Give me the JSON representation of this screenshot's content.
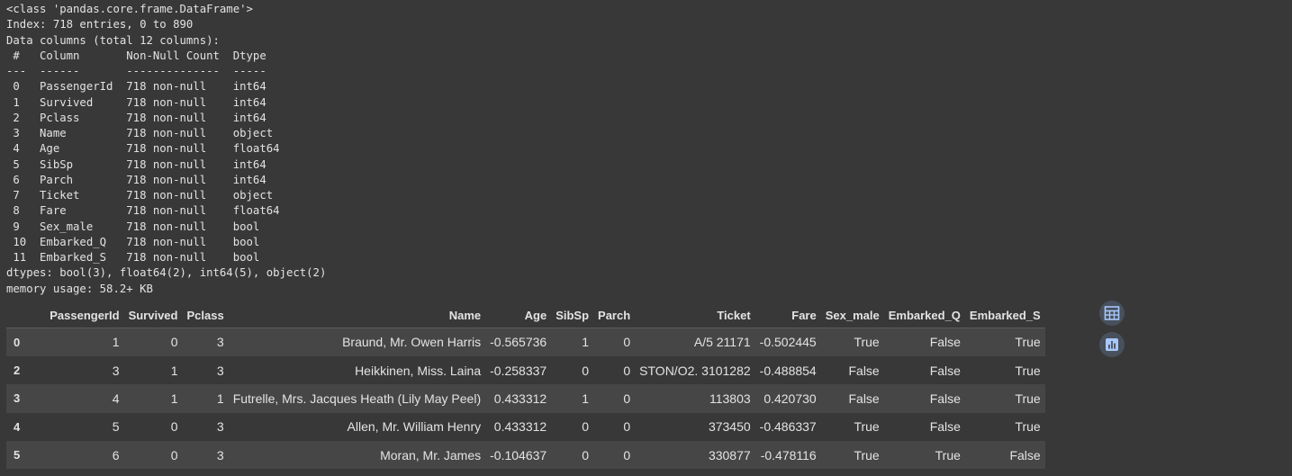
{
  "info": {
    "lines": [
      "<class 'pandas.core.frame.DataFrame'>",
      "Index: 718 entries, 0 to 890",
      "Data columns (total 12 columns):",
      " #   Column       Non-Null Count  Dtype  ",
      "---  ------       --------------  -----  ",
      " 0   PassengerId  718 non-null    int64  ",
      " 1   Survived     718 non-null    int64  ",
      " 2   Pclass       718 non-null    int64  ",
      " 3   Name         718 non-null    object ",
      " 4   Age          718 non-null    float64",
      " 5   SibSp        718 non-null    int64  ",
      " 6   Parch        718 non-null    int64  ",
      " 7   Ticket       718 non-null    object ",
      " 8   Fare         718 non-null    float64",
      " 9   Sex_male     718 non-null    bool   ",
      " 10  Embarked_Q   718 non-null    bool   ",
      " 11  Embarked_S   718 non-null    bool   ",
      "dtypes: bool(3), float64(2), int64(5), object(2)",
      "memory usage: 58.2+ KB"
    ]
  },
  "dataframe": {
    "columns": [
      "PassengerId",
      "Survived",
      "Pclass",
      "Name",
      "Age",
      "SibSp",
      "Parch",
      "Ticket",
      "Fare",
      "Sex_male",
      "Embarked_Q",
      "Embarked_S"
    ],
    "rows": [
      {
        "index": "0",
        "cells": [
          "1",
          "0",
          "3",
          "Braund, Mr. Owen Harris",
          "-0.565736",
          "1",
          "0",
          "A/5 21171",
          "-0.502445",
          "True",
          "False",
          "True"
        ]
      },
      {
        "index": "2",
        "cells": [
          "3",
          "1",
          "3",
          "Heikkinen, Miss. Laina",
          "-0.258337",
          "0",
          "0",
          "STON/O2. 3101282",
          "-0.488854",
          "False",
          "False",
          "True"
        ]
      },
      {
        "index": "3",
        "cells": [
          "4",
          "1",
          "1",
          "Futrelle, Mrs. Jacques Heath (Lily May Peel)",
          "0.433312",
          "1",
          "0",
          "113803",
          "0.420730",
          "False",
          "False",
          "True"
        ]
      },
      {
        "index": "4",
        "cells": [
          "5",
          "0",
          "3",
          "Allen, Mr. William Henry",
          "0.433312",
          "0",
          "0",
          "373450",
          "-0.486337",
          "True",
          "False",
          "True"
        ]
      },
      {
        "index": "5",
        "cells": [
          "6",
          "0",
          "3",
          "Moran, Mr. James",
          "-0.104637",
          "0",
          "0",
          "330877",
          "-0.478116",
          "True",
          "True",
          "False"
        ]
      }
    ]
  },
  "side_buttons": {
    "table_icon": "table-grid-icon",
    "chart_icon": "bar-chart-icon",
    "accent_color": "#a8c7fa",
    "bg_color": "#48505c"
  }
}
